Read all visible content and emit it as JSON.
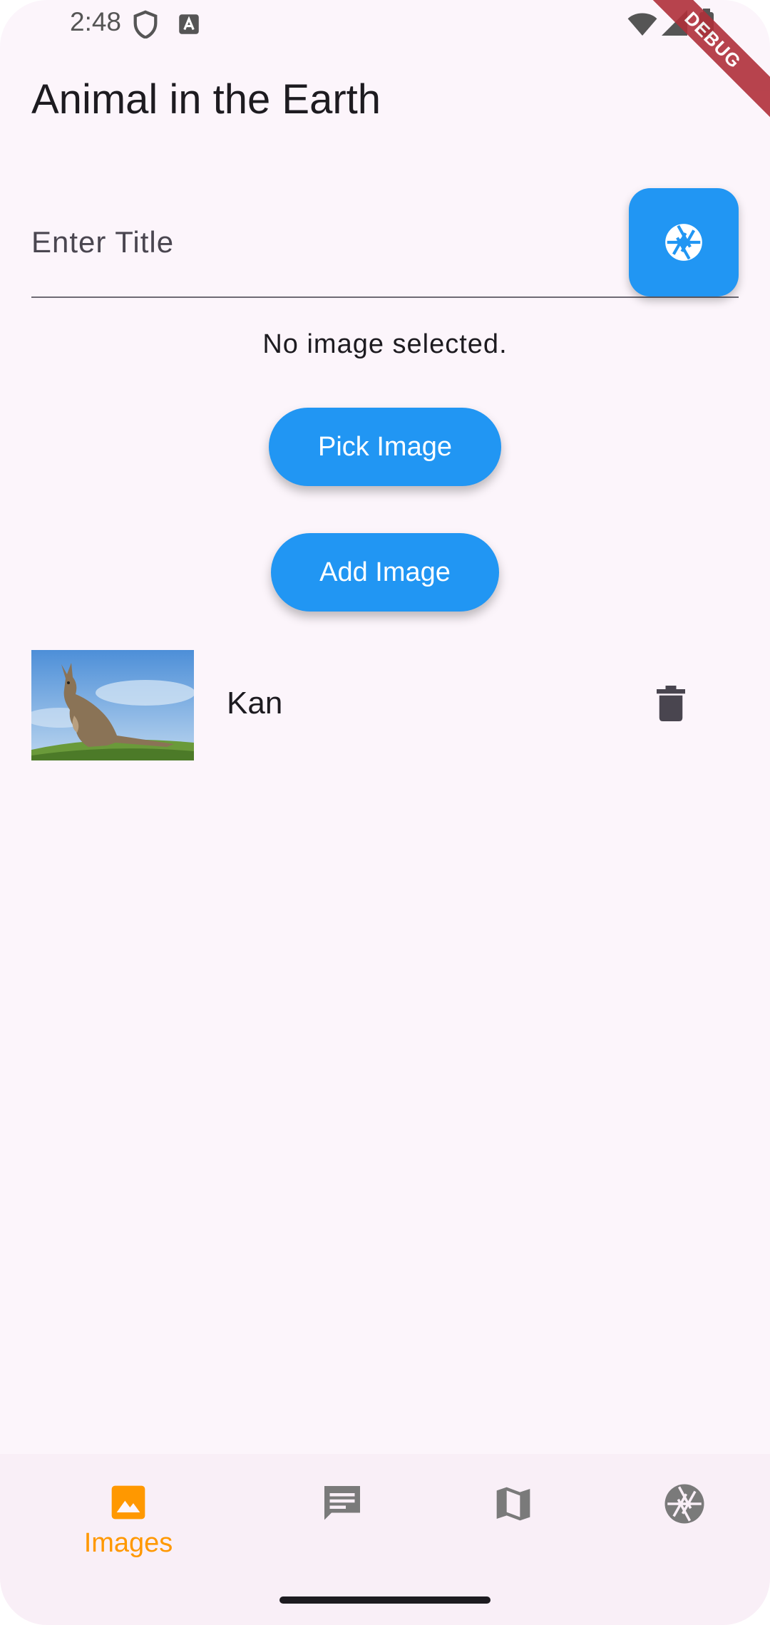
{
  "status_bar": {
    "time": "2:48",
    "icons": [
      "shield-icon",
      "a-badge-icon",
      "wifi-icon",
      "signal-icon",
      "battery-icon"
    ]
  },
  "debug_banner": "DEBUG",
  "app_bar": {
    "title": "Animal in the Earth"
  },
  "title_field": {
    "placeholder": "Enter Title",
    "value": ""
  },
  "fab": {
    "icon": "camera-shutter-icon"
  },
  "status_message": "No image selected.",
  "buttons": {
    "pick_image": "Pick Image",
    "add_image": "Add Image"
  },
  "images_list": [
    {
      "title": "Kan",
      "thumbnail": "kangaroo-photo",
      "delete_icon": "trash-icon"
    }
  ],
  "bottom_nav": {
    "items": [
      {
        "label": "Images",
        "icon": "image-icon",
        "selected": true
      },
      {
        "label": "",
        "icon": "chat-icon",
        "selected": false
      },
      {
        "label": "",
        "icon": "map-icon",
        "selected": false
      },
      {
        "label": "",
        "icon": "camera-shutter-icon",
        "selected": false
      }
    ]
  },
  "colors": {
    "primary": "#2196f3",
    "selected_nav": "#ff9800",
    "background": "#fcf5fb",
    "debug_ribbon": "#b0303a"
  }
}
